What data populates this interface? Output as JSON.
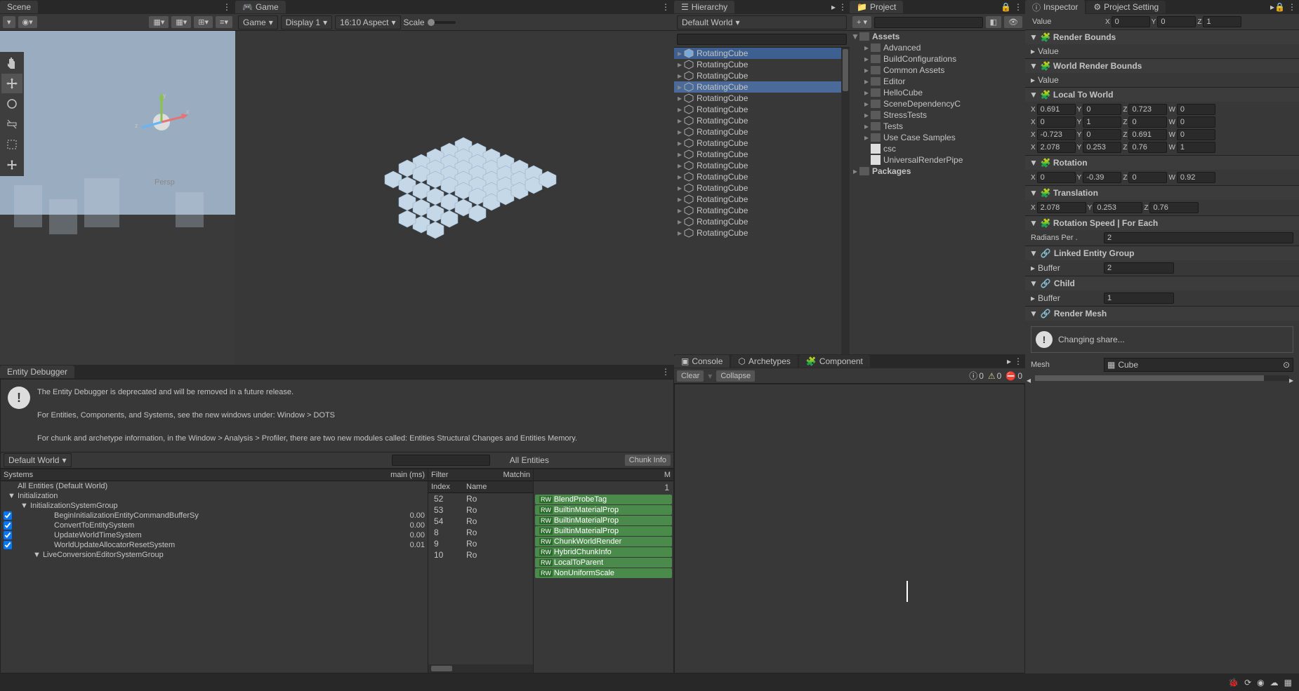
{
  "scene_tab": "Scene",
  "game_tab": "Game",
  "hierarchy_tab": "Hierarchy",
  "project_tab": "Project",
  "inspector_tab": "Inspector",
  "project_settings_tab": "Project Setting",
  "entity_debugger_tab": "Entity Debugger",
  "console_tab": "Console",
  "archetypes_tab": "Archetypes",
  "components_tab": "Component",
  "game_toolbar": {
    "camera": "Game",
    "display": "Display 1",
    "aspect": "16:10 Aspect",
    "scale_label": "Scale"
  },
  "scene_persp": "Persp",
  "hierarchy": {
    "world": "Default World",
    "items": [
      "RotatingCube",
      "RotatingCube",
      "RotatingCube",
      "RotatingCube",
      "RotatingCube",
      "RotatingCube",
      "RotatingCube",
      "RotatingCube",
      "RotatingCube",
      "RotatingCube",
      "RotatingCube",
      "RotatingCube",
      "RotatingCube",
      "RotatingCube",
      "RotatingCube",
      "RotatingCube",
      "RotatingCube"
    ],
    "selected_index": 0,
    "highlighted_index": 3
  },
  "project": {
    "root": "Assets",
    "items": [
      "Advanced",
      "BuildConfigurations",
      "Common Assets",
      "Editor",
      "HelloCube",
      "SceneDependencyC",
      "StressTests",
      "Tests",
      "Use Case Samples"
    ],
    "files": [
      "csc",
      "UniversalRenderPipe"
    ],
    "packages": "Packages"
  },
  "console": {
    "clear": "Clear",
    "collapse": "Collapse",
    "info_count": "0",
    "warn_count": "0",
    "err_count": "0"
  },
  "debugger": {
    "msg1": "The Entity Debugger is deprecated and will be removed in a future release.",
    "msg2": "For Entities, Components, and Systems, see the new windows under: Window > DOTS",
    "msg3": "For chunk and archetype information, in the Window > Analysis > Profiler, there are two new modules called: Entities Structural Changes and Entities Memory.",
    "world": "Default World",
    "all_entities": "All Entities",
    "chunk_info": "Chunk Info",
    "systems_header": "Systems",
    "main_ms": "main (ms)",
    "filter": "Filter",
    "matching": "Matchin",
    "m_header": "M",
    "index_header": "Index",
    "name_header": "Name",
    "all_entities_world": "All Entities (Default World)",
    "systems": [
      {
        "name": "Initialization",
        "time": "",
        "group": true,
        "indent": 0
      },
      {
        "name": "InitializationSystemGroup",
        "time": "",
        "group": true,
        "indent": 1
      },
      {
        "name": "BeginInitializationEntityCommandBufferSy",
        "time": "0.00",
        "indent": 2
      },
      {
        "name": "ConvertToEntitySystem",
        "time": "0.00",
        "indent": 2
      },
      {
        "name": "UpdateWorldTimeSystem",
        "time": "0.00",
        "indent": 2
      },
      {
        "name": "WorldUpdateAllocatorResetSystem",
        "time": "0.01",
        "indent": 2
      },
      {
        "name": "LiveConversionEditorSystemGroup",
        "time": "",
        "group": true,
        "indent": 2
      }
    ],
    "entity_rows": [
      {
        "idx": "52",
        "name": "Ro"
      },
      {
        "idx": "53",
        "name": "Ro"
      },
      {
        "idx": "54",
        "name": "Ro"
      },
      {
        "idx": "8",
        "name": "Ro"
      },
      {
        "idx": "9",
        "name": "Ro"
      },
      {
        "idx": "10",
        "name": "Ro"
      }
    ],
    "component_count": "1",
    "components": [
      "BlendProbeTag",
      "BuiltinMaterialProp",
      "BuiltinMaterialProp",
      "BuiltinMaterialProp",
      "ChunkWorldRender",
      "HybridChunkInfo",
      "LocalToParent",
      "NonUniformScale"
    ]
  },
  "inspector": {
    "value_label": "Value",
    "buffer_label": "Buffer",
    "transform_xyz": {
      "x": "0",
      "y": "0",
      "z": "1"
    },
    "render_bounds": "Render Bounds",
    "world_render_bounds": "World Render Bounds",
    "local_to_world": "Local To World",
    "ltw": [
      {
        "x": "0.691",
        "y": "0",
        "z": "0.723",
        "w": "0"
      },
      {
        "x": "0",
        "y": "1",
        "z": "0",
        "w": "0"
      },
      {
        "x": "-0.723",
        "y": "0",
        "z": "0.691",
        "w": "0"
      },
      {
        "x": "2.078",
        "y": "0.253",
        "z": "0.76",
        "w": "1"
      }
    ],
    "rotation": "Rotation",
    "rotation_val": {
      "x": "0",
      "y": "-0.39",
      "z": "0",
      "w": "0.92"
    },
    "translation": "Translation",
    "translation_val": {
      "x": "2.078",
      "y": "0.253",
      "z": "0.76"
    },
    "rotation_speed": "Rotation Speed | For Each",
    "radians_label": "Radians Per .",
    "radians_val": "2",
    "linked_group": "Linked Entity Group",
    "linked_buffer": "2",
    "child": "Child",
    "child_buffer": "1",
    "render_mesh": "Render Mesh",
    "changing_share": "Changing share...",
    "mesh_label": "Mesh",
    "mesh_val": "Cube"
  }
}
